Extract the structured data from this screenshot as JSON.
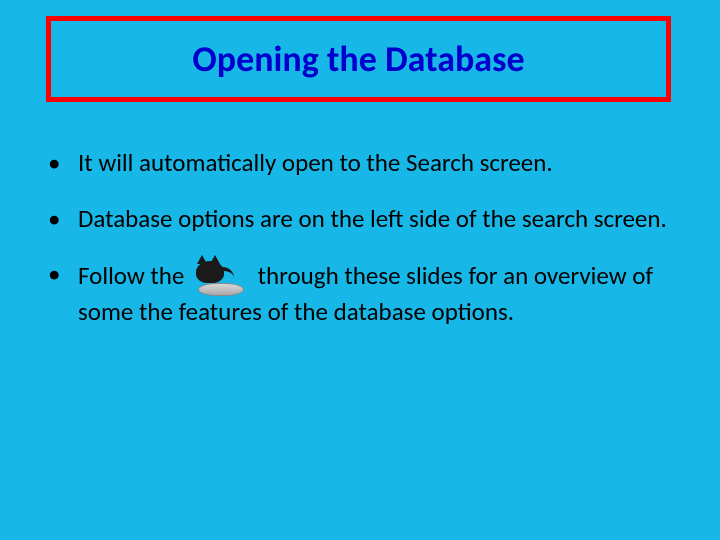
{
  "title": "Opening the Database",
  "bullets": {
    "b1": "It will automatically open to the Search screen.",
    "b2": "Database options are on the left side of the search screen.",
    "b3a": "Follow the ",
    "b3b": " through these slides for an overview of some the features of the database options."
  }
}
